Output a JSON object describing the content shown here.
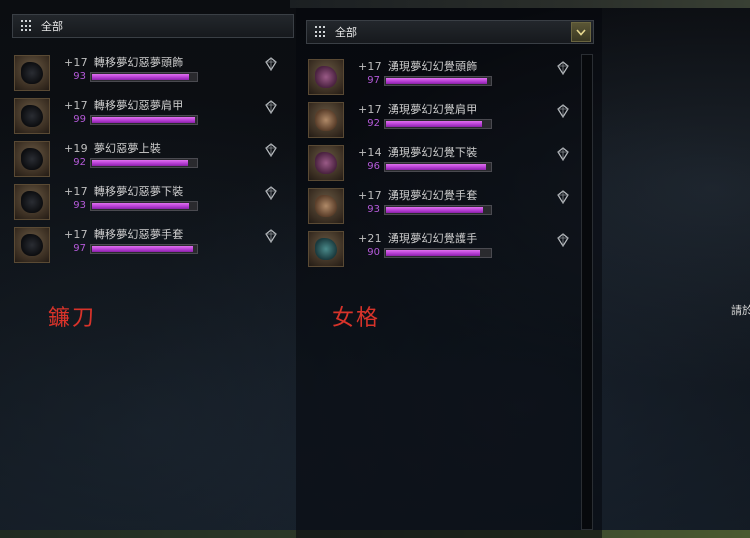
{
  "left_panel": {
    "filter": {
      "selected": "全部"
    },
    "items": [
      {
        "level": "+17",
        "name": "轉移夢幻惡夢頭飾",
        "value": "93",
        "progress": 0.93,
        "icon": "helmet-icon",
        "tone": "dark"
      },
      {
        "level": "+17",
        "name": "轉移夢幻惡夢肩甲",
        "value": "99",
        "progress": 0.99,
        "icon": "pauldron-icon",
        "tone": "dark"
      },
      {
        "level": "+19",
        "name": "夢幻惡夢上裝",
        "value": "92",
        "progress": 0.92,
        "icon": "chest-armor-icon",
        "tone": "dark"
      },
      {
        "level": "+17",
        "name": "轉移夢幻惡夢下裝",
        "value": "93",
        "progress": 0.93,
        "icon": "leg-armor-icon",
        "tone": "dark"
      },
      {
        "level": "+17",
        "name": "轉移夢幻惡夢手套",
        "value": "97",
        "progress": 0.97,
        "icon": "gauntlet-icon",
        "tone": "dark"
      }
    ],
    "annotation": "鐮刀"
  },
  "right_panel": {
    "filter": {
      "selected": "全部"
    },
    "items": [
      {
        "level": "+17",
        "name": "湧現夢幻幻覺頭飾",
        "value": "97",
        "progress": 0.97,
        "icon": "helmet-icon",
        "tone": "plum"
      },
      {
        "level": "+17",
        "name": "湧現夢幻幻覺肩甲",
        "value": "92",
        "progress": 0.92,
        "icon": "pauldron-icon",
        "tone": "tan"
      },
      {
        "level": "+14",
        "name": "湧現夢幻幻覺下裝",
        "value": "96",
        "progress": 0.96,
        "icon": "leg-armor-icon",
        "tone": "plum"
      },
      {
        "level": "+17",
        "name": "湧現夢幻幻覺手套",
        "value": "93",
        "progress": 0.93,
        "icon": "glove-icon",
        "tone": "tan"
      },
      {
        "level": "+21",
        "name": "湧現夢幻幻覺護手",
        "value": "90",
        "progress": 0.9,
        "icon": "bracer-icon",
        "tone": "teal"
      }
    ],
    "annotation": "女格"
  },
  "side_text": "請於",
  "colors": {
    "bar_fill": "#c040e0",
    "value_text": "#b45ad8",
    "annotation": "#d8332a"
  }
}
